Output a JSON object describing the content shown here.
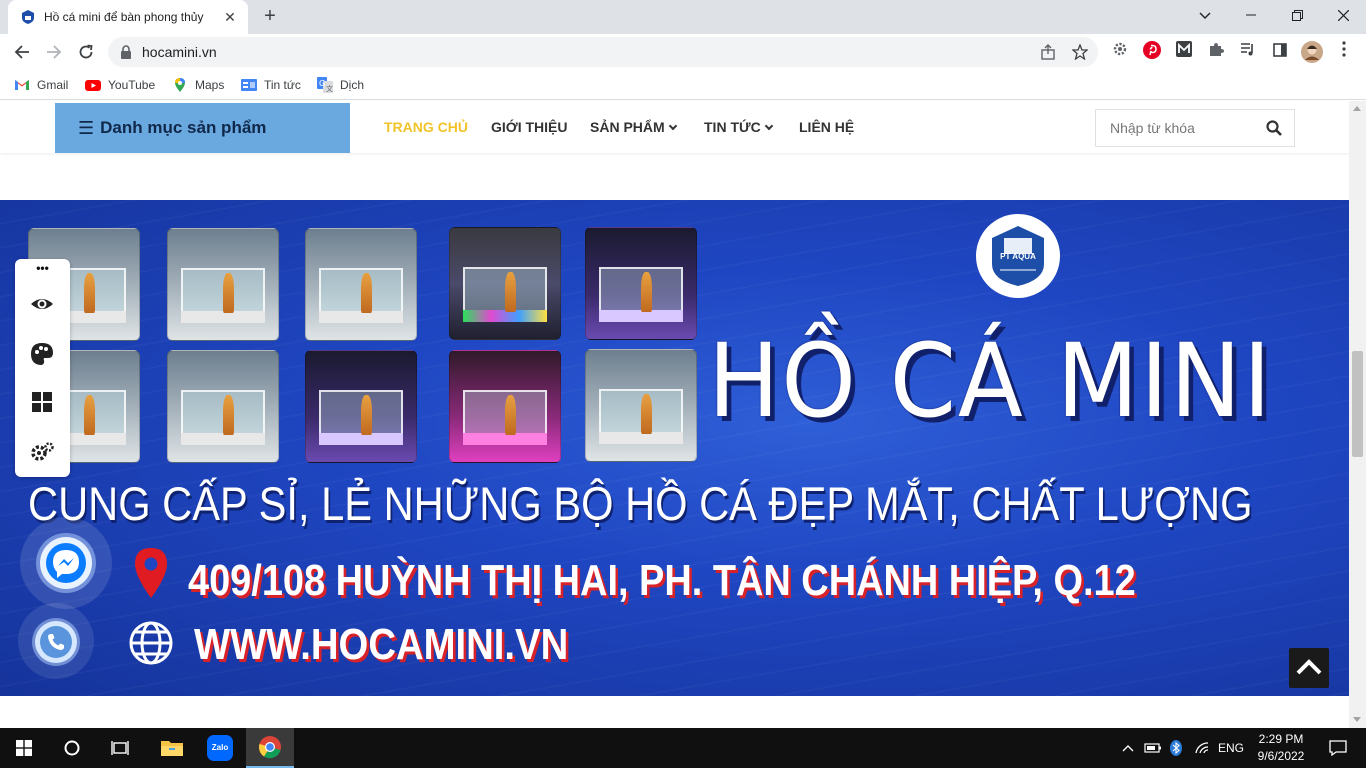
{
  "browser": {
    "tab_title": "Hồ cá mini để bàn phong thủy",
    "tab_close": "✕",
    "new_tab": "+",
    "url": "hocamini.vn",
    "window_controls": {
      "minimize": "—",
      "maximize": "❐",
      "close": "✕"
    },
    "bookmarks": [
      {
        "label": "Gmail",
        "icon": "gmail-icon"
      },
      {
        "label": "YouTube",
        "icon": "youtube-icon"
      },
      {
        "label": "Maps",
        "icon": "maps-icon"
      },
      {
        "label": "Tin tức",
        "icon": "news-icon"
      },
      {
        "label": "Dịch",
        "icon": "translate-icon"
      }
    ]
  },
  "site": {
    "category_menu": "Danh mục sản phẩm",
    "nav": [
      {
        "label": "TRANG CHỦ",
        "active": true
      },
      {
        "label": "GIỚI THIỆU",
        "active": false
      },
      {
        "label": "SẢN PHẨM",
        "active": false,
        "dropdown": true
      },
      {
        "label": "TIN TỨC",
        "active": false,
        "dropdown": true
      },
      {
        "label": "LIÊN HỆ",
        "active": false
      }
    ],
    "search_placeholder": "Nhập từ khóa",
    "accent_color": "#f2c42a",
    "category_bg": "#6aa8e0"
  },
  "banner": {
    "logo_text": "PT AQUA",
    "headline": "HỒ CÁ MINI",
    "tagline": "CUNG CẤP SỈ, LẺ NHỮNG BỘ HỒ CÁ ĐẸP MẮT, CHẤT LƯỢNG",
    "address": "409/108 HUỲNH THỊ HAI, PH. TÂN CHÁNH HIỆP, Q.12",
    "website": "WWW.HOCAMINI.VN"
  },
  "side_tools": {
    "more": "•••",
    "items": [
      "eye-icon",
      "palette-icon",
      "grid-icon",
      "settings-icon"
    ]
  },
  "taskbar": {
    "time": "2:29 PM",
    "date": "9/6/2022",
    "language": "ENG",
    "zalo_label": "Zalo"
  }
}
